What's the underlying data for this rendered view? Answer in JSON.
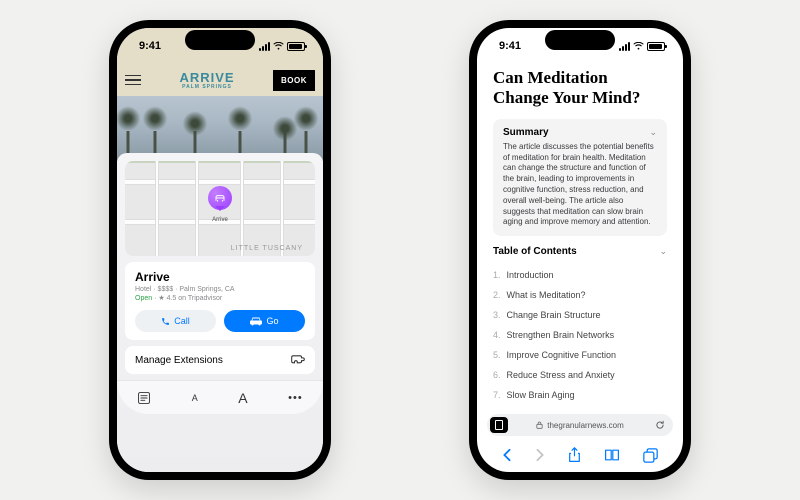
{
  "status": {
    "time": "9:41"
  },
  "phone1": {
    "header": {
      "brand": "ARRIVE",
      "brand_sub": "PALM SPRINGS",
      "book": "BOOK"
    },
    "map": {
      "pin_label": "Arrive",
      "area_label": "LITTLE TUSCANY"
    },
    "place": {
      "name": "Arrive",
      "meta": "Hotel · $$$$ · Palm Springs, CA",
      "status_open": "Open",
      "rating_text": " · ★ 4.5 on Tripadvisor",
      "call": "Call",
      "go": "Go"
    },
    "extensions": {
      "label": "Manage Extensions"
    },
    "toolbar": {
      "reader": "",
      "small_a": "A",
      "large_a": "A",
      "more": "•••"
    }
  },
  "phone2": {
    "article": {
      "title": "Can Meditation Change Your Mind?",
      "summary_heading": "Summary",
      "summary_text": "The article discusses the potential benefits of meditation for brain health. Meditation can change the structure and function of the brain, leading to improvements in cognitive function, stress reduction, and overall well-being. The article also suggests that meditation can slow brain aging and improve memory and attention.",
      "toc_heading": "Table of Contents",
      "toc": [
        "Introduction",
        "What is Meditation?",
        "Change Brain Structure",
        "Strengthen Brain Networks",
        "Improve Cognitive Function",
        "Reduce Stress and Anxiety",
        "Slow Brain Aging"
      ]
    },
    "safari": {
      "url": "thegranularnews.com"
    }
  }
}
